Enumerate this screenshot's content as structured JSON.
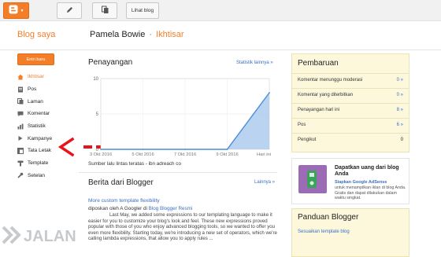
{
  "toolbar": {
    "blogger_icon": "blogger-icon",
    "edit_icon": "pencil-icon",
    "pages_icon": "copy-pages-icon",
    "view_blog_label": "Lihat blog"
  },
  "header": {
    "brand": "Blog saya",
    "blog_name": "Pamela Bowie",
    "separator": "·",
    "section": "Ikhtisar"
  },
  "sidebar": {
    "new_post_label": "Entri baru",
    "items": [
      {
        "label": "Ikhtisar",
        "icon": "home-icon",
        "active": true
      },
      {
        "label": "Pos",
        "icon": "posts-icon"
      },
      {
        "label": "Laman",
        "icon": "pages-icon"
      },
      {
        "label": "Komentar",
        "icon": "comments-icon"
      },
      {
        "label": "Statistik",
        "icon": "stats-icon"
      },
      {
        "label": "Kampanye",
        "icon": "campaign-icon"
      },
      {
        "label": "Tata Letak",
        "icon": "layout-icon"
      },
      {
        "label": "Template",
        "icon": "template-icon"
      },
      {
        "label": "Setelan",
        "icon": "settings-icon"
      }
    ]
  },
  "pageviews": {
    "title": "Penayangan",
    "link": "Statistik lainnya »",
    "traffic_sources": "Sumber lalu lintas teratas - ibn adreach co"
  },
  "chart_data": {
    "type": "area",
    "x": [
      "3 Okt 2016",
      "5 Okt 2016",
      "7 Okt 2016",
      "9 Okt 2016",
      "Hari ini"
    ],
    "series": [
      {
        "values": [
          0,
          0,
          0,
          0,
          8
        ]
      }
    ],
    "ylim": [
      0,
      10
    ],
    "yticks": [
      "10",
      "5",
      "0"
    ],
    "grid": true,
    "color": "#4a8fd6"
  },
  "news": {
    "title": "Berita dari Blogger",
    "link": "Lainnya »",
    "post_title": "More custom template flexibility",
    "byline_prefix": "diposkan oleh A Googler di ",
    "byline_link": "Blog Blogger Resmi",
    "excerpt": "Last May, we added some expressions to our templating language to make it easier for you to customize your blog's look and feel. These new expressions proved popular with those of you who enjoy advanced blogging tools, so we wanted to offer you even more flexibility. Starting today, we're introducing a new set of operators, which we're calling lambda expressions, that allow you to apply rules ..."
  },
  "updates": {
    "title": "Pembaruan",
    "rows": [
      {
        "label": "Komentar menunggu moderasi",
        "value": "0 »"
      },
      {
        "label": "Komentar yang diterbitkan",
        "value": "0 »"
      },
      {
        "label": "Penayangan hari ini",
        "value": "8 »"
      },
      {
        "label": "Pos",
        "value": "6 »"
      },
      {
        "label": "Pengikut",
        "value": "0"
      }
    ]
  },
  "ad": {
    "title": "Dapatkan uang dari blog Anda",
    "link": "Siapkan Google AdSense",
    "text": "untuk menampilkan iklan di blog Anda. Gratis dan dapat dilakukan dalam waktu singkat."
  },
  "guide": {
    "title": "Panduan Blogger",
    "link": "Sesuaikan template blog"
  },
  "watermark": {
    "text": "JALAN"
  }
}
